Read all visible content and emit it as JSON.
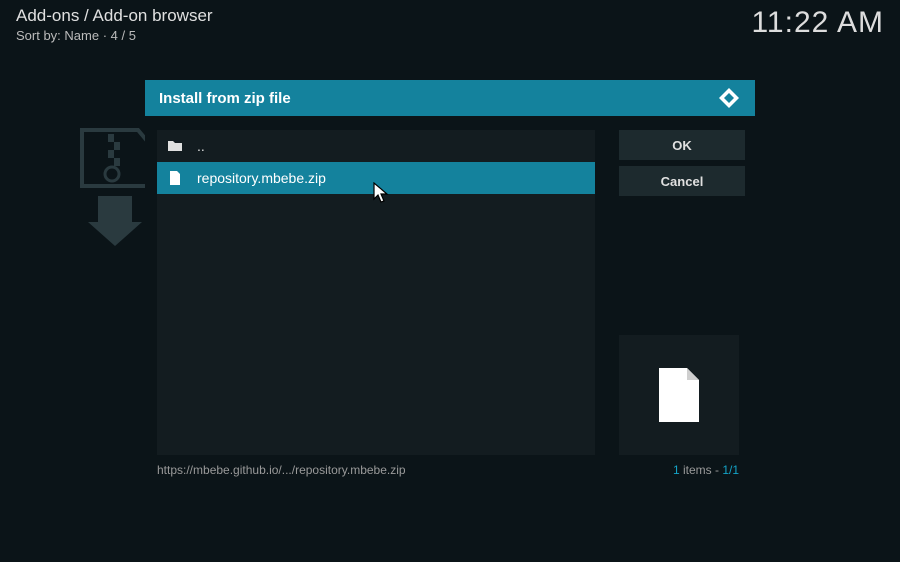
{
  "header": {
    "breadcrumb": "Add-ons / Add-on browser",
    "sort_prefix": "Sort by: ",
    "sort_value": "Name",
    "paging": "4 / 5",
    "time": "11:22 AM"
  },
  "dialog": {
    "title": "Install from zip file",
    "parent_label": "..",
    "file_label": "repository.mbebe.zip",
    "ok_label": "OK",
    "cancel_label": "Cancel",
    "footer_path": "https://mbebe.github.io/.../repository.mbebe.zip",
    "footer_count": "1",
    "footer_items_word": " items - ",
    "footer_page": "1/1"
  },
  "colors": {
    "accent": "#14829d"
  }
}
